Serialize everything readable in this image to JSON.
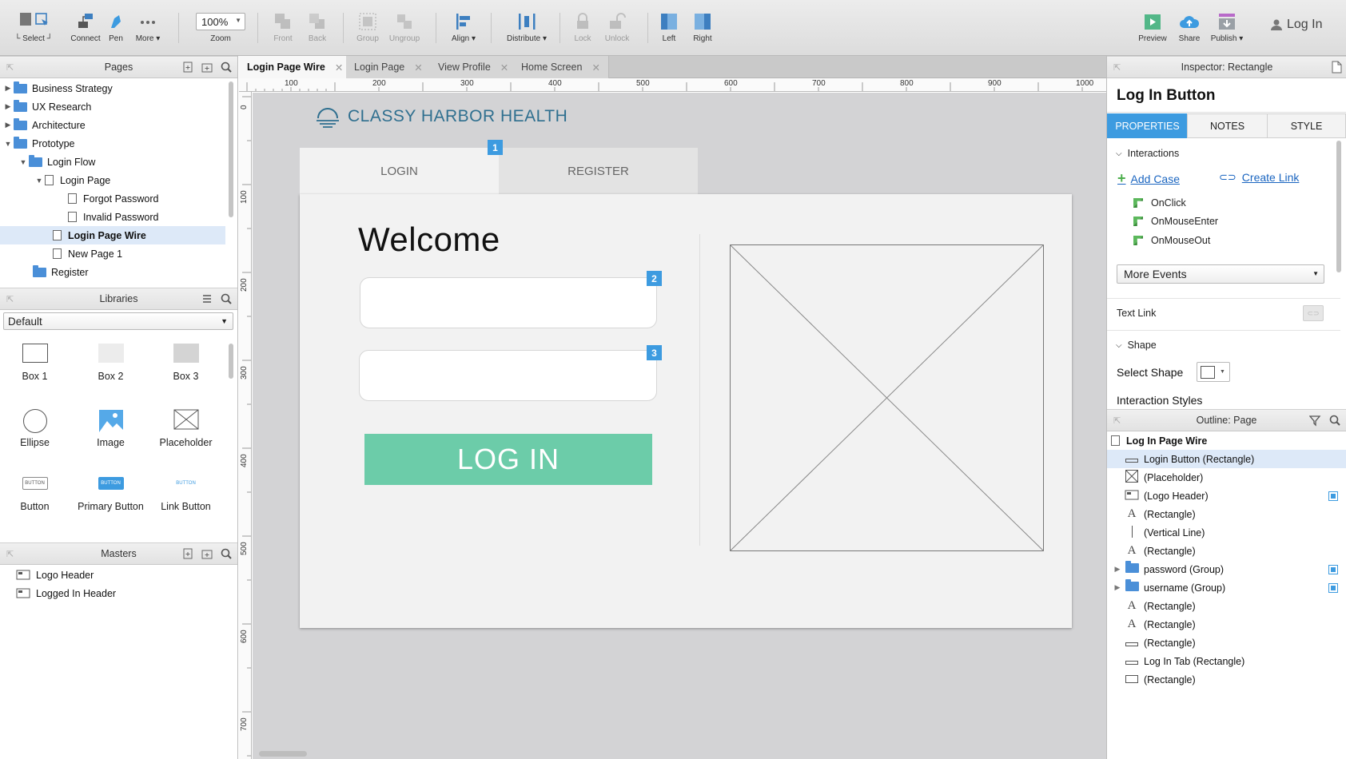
{
  "toolbar": {
    "select": "Select",
    "connect": "Connect",
    "pen": "Pen",
    "more": "More ▾",
    "zoom_value": "100%",
    "zoom": "Zoom",
    "front": "Front",
    "back": "Back",
    "group": "Group",
    "ungroup": "Ungroup",
    "align": "Align ▾",
    "distribute": "Distribute ▾",
    "lock": "Lock",
    "unlock": "Unlock",
    "left": "Left",
    "right": "Right",
    "preview": "Preview",
    "share": "Share",
    "publish": "Publish ▾",
    "login": "Log In"
  },
  "pages_panel": {
    "title": "Pages",
    "items": [
      {
        "label": "Business Strategy"
      },
      {
        "label": "UX Research"
      },
      {
        "label": "Architecture"
      },
      {
        "label": "Prototype"
      },
      {
        "label": "Login Flow"
      },
      {
        "label": "Login Page"
      },
      {
        "label": "Forgot Password"
      },
      {
        "label": "Invalid Password"
      },
      {
        "label": "Login Page Wire"
      },
      {
        "label": "New Page 1"
      },
      {
        "label": "Register"
      }
    ]
  },
  "libraries_panel": {
    "title": "Libraries",
    "selected": "Default",
    "items": [
      {
        "label": "Box 1"
      },
      {
        "label": "Box 2"
      },
      {
        "label": "Box 3"
      },
      {
        "label": "Ellipse"
      },
      {
        "label": "Image"
      },
      {
        "label": "Placeholder"
      },
      {
        "label": "Button"
      },
      {
        "label": "Primary Button"
      },
      {
        "label": "Link Button"
      }
    ],
    "button_text": "BUTTON"
  },
  "masters_panel": {
    "title": "Masters",
    "items": [
      {
        "label": "Logo Header"
      },
      {
        "label": "Logged In Header"
      }
    ]
  },
  "tabs": [
    {
      "label": "Login Page Wire"
    },
    {
      "label": "Login Page"
    },
    {
      "label": "View Profile"
    },
    {
      "label": "Home Screen"
    }
  ],
  "ruler": {
    "h": [
      "100",
      "200",
      "300",
      "400",
      "500",
      "600",
      "700",
      "800",
      "900",
      "1000"
    ],
    "v": [
      "0",
      "100",
      "200",
      "300",
      "400",
      "500",
      "600",
      "700"
    ]
  },
  "wireframe": {
    "brand": "CLASSY HARBOR HEALTH",
    "tab_login": "LOGIN",
    "tab_register": "REGISTER",
    "welcome": "Welcome",
    "login_button": "LOG IN",
    "badges": [
      "1",
      "2",
      "3"
    ],
    "accent": "#6ccca9"
  },
  "inspector": {
    "title": "Inspector: Rectangle",
    "name": "Log In Button",
    "tabs": [
      "PROPERTIES",
      "NOTES",
      "STYLE"
    ],
    "interactions": "Interactions",
    "add_case": "Add Case",
    "create_link": "Create Link",
    "events": [
      "OnClick",
      "OnMouseEnter",
      "OnMouseOut"
    ],
    "more_events": "More Events",
    "text_link": "Text Link",
    "shape": "Shape",
    "select_shape": "Select Shape",
    "interaction_styles": "Interaction Styles"
  },
  "outline": {
    "title": "Outline: Page",
    "root": "Log In Page Wire",
    "items": [
      {
        "label": "Login Button (Rectangle)",
        "icon": "rect-icon"
      },
      {
        "label": "(Placeholder)",
        "icon": "placeholder-icon"
      },
      {
        "label": "(Logo Header)",
        "icon": "master-icon"
      },
      {
        "label": "(Rectangle)",
        "icon": "text-icon"
      },
      {
        "label": "(Vertical Line)",
        "icon": "line-icon"
      },
      {
        "label": "(Rectangle)",
        "icon": "text-icon"
      },
      {
        "label": "password (Group)",
        "icon": "folder-icon"
      },
      {
        "label": "username (Group)",
        "icon": "folder-icon"
      },
      {
        "label": "(Rectangle)",
        "icon": "text-icon"
      },
      {
        "label": "(Rectangle)",
        "icon": "text-icon"
      },
      {
        "label": "(Rectangle)",
        "icon": "rect-icon"
      },
      {
        "label": "Log In Tab (Rectangle)",
        "icon": "rect-icon"
      },
      {
        "label": "(Rectangle)",
        "icon": "box-icon"
      }
    ]
  },
  "colors": {
    "accent_blue": "#3d9be0",
    "brand_text": "#2f6f8f",
    "login_green": "#6ccca9"
  }
}
